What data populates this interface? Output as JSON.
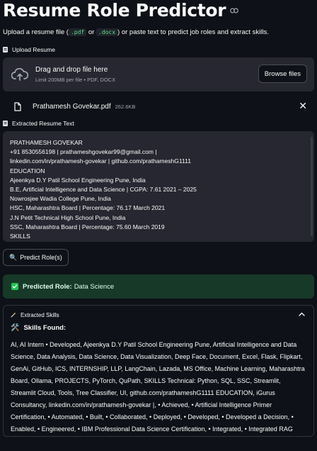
{
  "page": {
    "title": "Resume Role Predictor",
    "subtitle_before": "Upload a resume file (",
    "ext_pdf": ".pdf",
    "subtitle_or": " or ",
    "ext_docx": ".docx",
    "subtitle_after": ") or paste text to predict job roles and extract skills."
  },
  "upload": {
    "section_label": "Upload Resume",
    "drop_title": "Drag and drop file here",
    "drop_hint": "Limit 200MB per file • PDF, DOCX",
    "browse_label": "Browse files",
    "file_name": "Prathamesh Govekar.pdf",
    "file_size": "262.6KB",
    "close_glyph": "✕"
  },
  "extracted": {
    "section_label": "Extracted Resume Text",
    "lines": [
      "PRATHAMESH GOVEKAR",
      "+91 8530556198 | prathameshgovekar99@gmail.com |",
      "linkedin.com/in/prathamesh-govekar | github.com/prathameshG1111",
      "EDUCATION",
      "Ajeenkya D.Y Patil School Engineering Pune, India",
      "B.E, Artificial Intelligence and Data Science | CGPA: 7.61 2021 – 2025",
      "Nowrosjee Wadia College Pune, India",
      "HSC, Maharashtra Board | Percentage: 76.17 March 2021",
      "J.N Petit Technical High School Pune, India",
      "SSC, Maharashtra Board | Percentage: 75.60 March 2019",
      "SKILLS"
    ]
  },
  "predict": {
    "button_label": "Predict Role(s)",
    "icon": "magnifier-icon"
  },
  "result": {
    "label": "Predicted Role:",
    "value": "Data Science"
  },
  "skills": {
    "expander_label": "Extracted Skills",
    "found_label": "Skills Found:",
    "text": "AI, AI Intern • Developed, Ajeenkya D.Y Patil School Engineering Pune, Artificial Intelligence and Data Science, Data Analysis, Data Science, Data Visualization, Deep Face, Document, Excel, Flask, Flipkart, GenAi, GitHub, ICS, INTERNSHIP, LLP, LangChain, Lazada, MS Office, Machine Learning, Maharashtra Board, Ollama, PROJECTS, PyTorch, QuPath, SKILLS Technical: Python, SQL, SSC, Streamlit, Streamlit Cloud, Tools, Tree Classifier, UI, github.com/prathameshG1111 EDUCATION, iGurus Consultancy, linkedin.com/in/prathamesh-govekar |, • Achieved, • Artificial Intelligence Primer Certification, • Automated, • Built, • Collaborated, • Deployed, • Developed, • Developed a Decision, • Enabled, • Engineered, • IBM Professional Data Science Certification, • Integrated, • Integrated RAG"
  },
  "colors": {
    "background": "#0e1117",
    "panel": "#262730",
    "success_bg": "#173928",
    "success_icon": "#21c354",
    "code_text": "#5ce488"
  }
}
